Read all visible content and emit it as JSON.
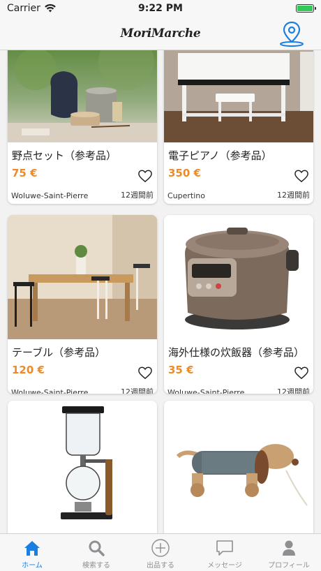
{
  "status_bar": {
    "carrier": "Carrier",
    "time": "9:22 PM"
  },
  "nav": {
    "title": "MoriMarche"
  },
  "items": [
    {
      "title": "野点セット（参考品）",
      "price": "75 €",
      "location": "Woluwe-Saint-Pierre",
      "time": "12週間前"
    },
    {
      "title": "電子ピアノ（参考品）",
      "price": "350 €",
      "location": "Cupertino",
      "time": "12週間前"
    },
    {
      "title": "テーブル（参考品）",
      "price": "120 €",
      "location": "Woluwe-Saint-Pierre",
      "time": "12週間前"
    },
    {
      "title": "海外仕様の炊飯器（参考品）",
      "price": "35 €",
      "location": "Woluwe-Saint-Pierre",
      "time": "12週間前"
    }
  ],
  "tabs": [
    {
      "label": "ホーム",
      "icon": "home-icon",
      "active": true
    },
    {
      "label": "検索する",
      "icon": "search-icon",
      "active": false
    },
    {
      "label": "出品する",
      "icon": "plus-circle-icon",
      "active": false
    },
    {
      "label": "メッセージ",
      "icon": "chat-icon",
      "active": false
    },
    {
      "label": "プロフィール",
      "icon": "person-icon",
      "active": false
    }
  ],
  "colors": {
    "accent": "#1a7fe0",
    "price": "#f08a24",
    "inactive": "#8e8e93"
  }
}
